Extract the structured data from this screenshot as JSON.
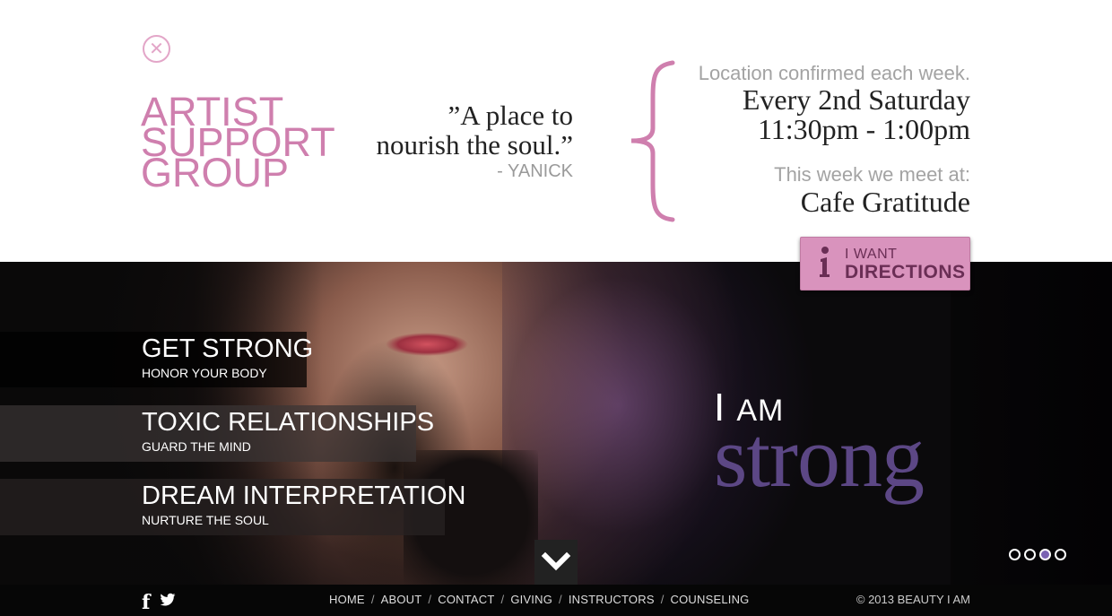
{
  "header": {
    "close_icon": "close-icon",
    "title_lines": [
      "ARTIST",
      "SUPPORT",
      "GROUP"
    ],
    "quote_line1": "”A place to",
    "quote_line2": "nourish the soul.”",
    "quote_author": "- YANICK",
    "location_note": "Location confirmed each week.",
    "schedule_day": "Every 2nd Saturday",
    "schedule_time": "11:30pm - 1:00pm",
    "meet_label": "This week we meet at:",
    "venue": "Cafe Gratitude",
    "directions_line1": "I WANT",
    "directions_line2": "DIRECTIONS",
    "accent_color": "#cf7fae"
  },
  "hero": {
    "menu": [
      {
        "title": "GET STRONG",
        "subtitle": "HONOR YOUR BODY"
      },
      {
        "title": "TOXIC RELATIONSHIPS",
        "subtitle": "GUARD THE MIND"
      },
      {
        "title": "DREAM INTERPRETATION",
        "subtitle": "NURTURE THE SOUL"
      }
    ],
    "tagline_prefix_i": "I",
    "tagline_prefix_am": "AM",
    "tagline_word": "strong",
    "tagline_color": "#5c4785",
    "slider_dots": 4,
    "active_slide": 3
  },
  "footer": {
    "facebook_icon": "f",
    "twitter_icon": "twitter-icon",
    "nav": [
      "HOME",
      "ABOUT",
      "CONTACT",
      "GIVING",
      "INSTRUCTORS",
      "COUNSELING"
    ],
    "separator": "/",
    "copyright": "© 2013 BEAUTY I AM"
  }
}
